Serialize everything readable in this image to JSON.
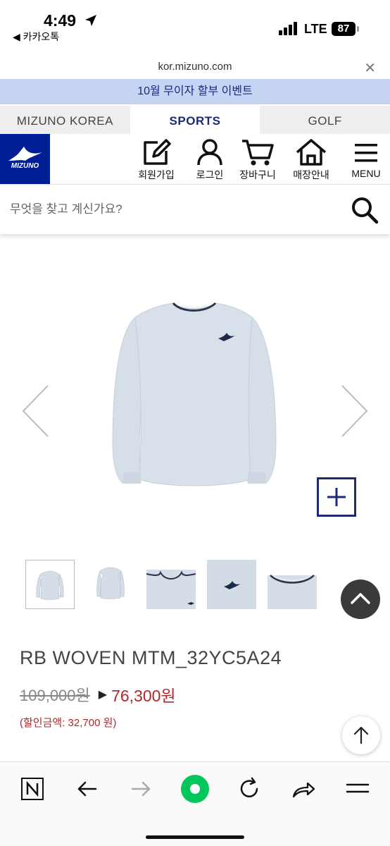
{
  "status_bar": {
    "time": "4:49",
    "back_app": "◀ 카카오톡",
    "network": "LTE",
    "battery": "87"
  },
  "browser": {
    "url": "kor.mizuno.com"
  },
  "banner": {
    "text": "10월 무이자 할부 이벤트"
  },
  "site_tabs": [
    {
      "label": "MIZUNO KOREA",
      "active": false
    },
    {
      "label": "SPORTS",
      "active": true
    },
    {
      "label": "GOLF",
      "active": false
    }
  ],
  "header": {
    "logo_text": "MIZUNO",
    "buttons": [
      {
        "label": "회원가입",
        "icon": "edit-icon"
      },
      {
        "label": "로그인",
        "icon": "user-icon"
      },
      {
        "label": "장바구니",
        "icon": "cart-icon"
      },
      {
        "label": "매장안내",
        "icon": "store-icon"
      },
      {
        "label": "MENU",
        "icon": "menu-icon"
      }
    ]
  },
  "search": {
    "placeholder": "무엇을 찾고 계신가요?"
  },
  "product": {
    "name": "RB WOVEN MTM_32YC5A24",
    "original_price": "109,000원",
    "sale_price": "76,300원",
    "discount": "(할인금액: 32,700 원)",
    "thumbnail_count": 5,
    "selected_thumbnail": 1
  },
  "colors": {
    "brand": "#001e96",
    "navy": "#1b2a7a",
    "sale": "#b3262b",
    "banner": "#c5d4f3",
    "garment": "#d5dde6",
    "browser_accent": "#03c75a"
  }
}
